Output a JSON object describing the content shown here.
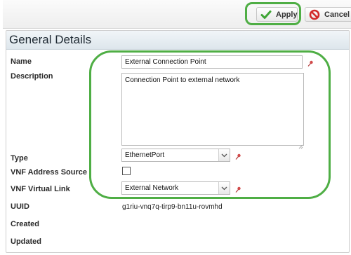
{
  "toolbar": {
    "apply_label": "Apply",
    "cancel_label": "Cancel",
    "highlight_color": "#4fae45"
  },
  "panel": {
    "title": "General Details"
  },
  "form": {
    "name": {
      "label": "Name",
      "value": "External Connection Point",
      "required": true
    },
    "description": {
      "label": "Description",
      "value": "Connection Point to external network"
    },
    "type": {
      "label": "Type",
      "value": "EthernetPort",
      "required": true
    },
    "vnf_address_source": {
      "label": "VNF Address Source",
      "checked": false
    },
    "vnf_virtual_link": {
      "label": "VNF Virtual Link",
      "value": "External Network",
      "required": true
    },
    "uuid": {
      "label": "UUID",
      "value": "g1riu-vnq7q-tirp9-bn11u-rovmhd"
    },
    "created": {
      "label": "Created",
      "value": ""
    },
    "updated": {
      "label": "Updated",
      "value": ""
    }
  },
  "icons": {
    "apply": "checkmark-icon",
    "cancel": "no-entry-icon",
    "required": "pin-icon",
    "dropdown": "chevron-down-icon"
  },
  "colors": {
    "accent_green": "#4fae45",
    "apply_check": "#3fa535",
    "cancel_red": "#d22a2a",
    "required_pin": "#d24a4a"
  }
}
